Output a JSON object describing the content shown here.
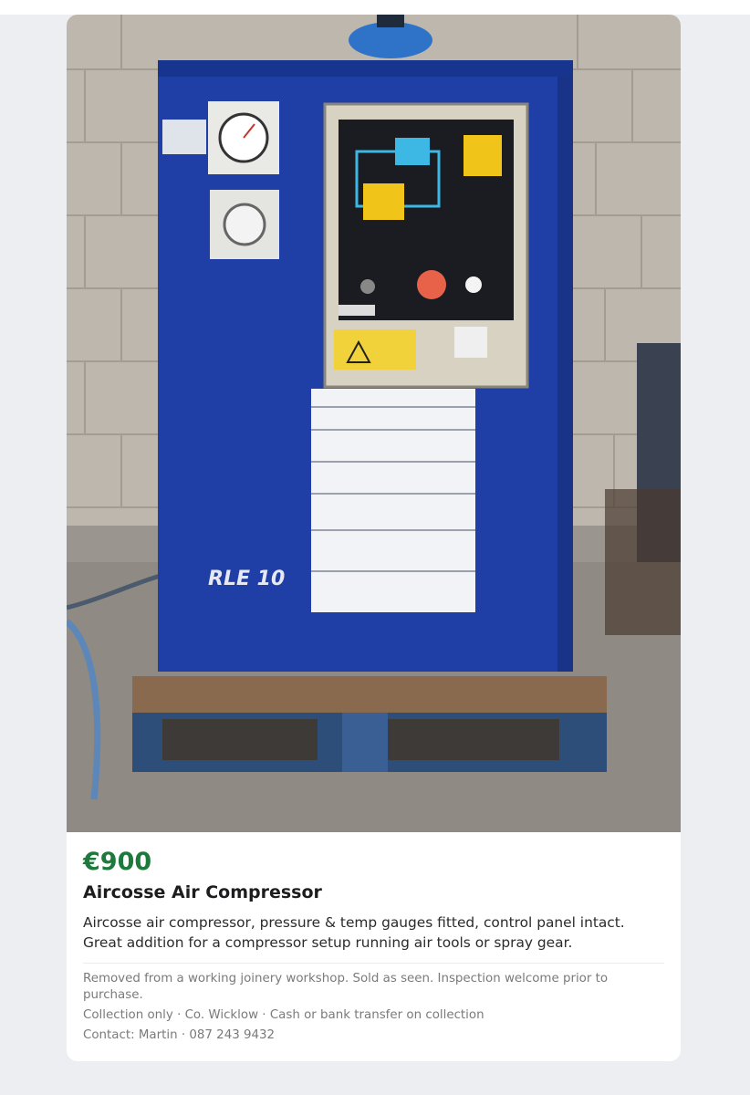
{
  "listing": {
    "price": "€900",
    "title": "Aircosse Air Compressor",
    "description": "Aircosse air compressor, pressure & temp gauges fitted, control panel intact. Great addition for a compressor setup running air tools or spray gear.",
    "details": "Removed from a working joinery workshop. Sold as seen. Inspection welcome prior to purchase.",
    "logistics": "Collection only · Co. Wicklow · Cash or bank transfer on collection",
    "contact": "Contact: Martin · 087 243 9432"
  },
  "photo": {
    "unit_text": "RLE 10"
  },
  "colors": {
    "price": "#1e7a3c",
    "unit_blue": "#1f3fa6",
    "background": "#eceef1"
  }
}
